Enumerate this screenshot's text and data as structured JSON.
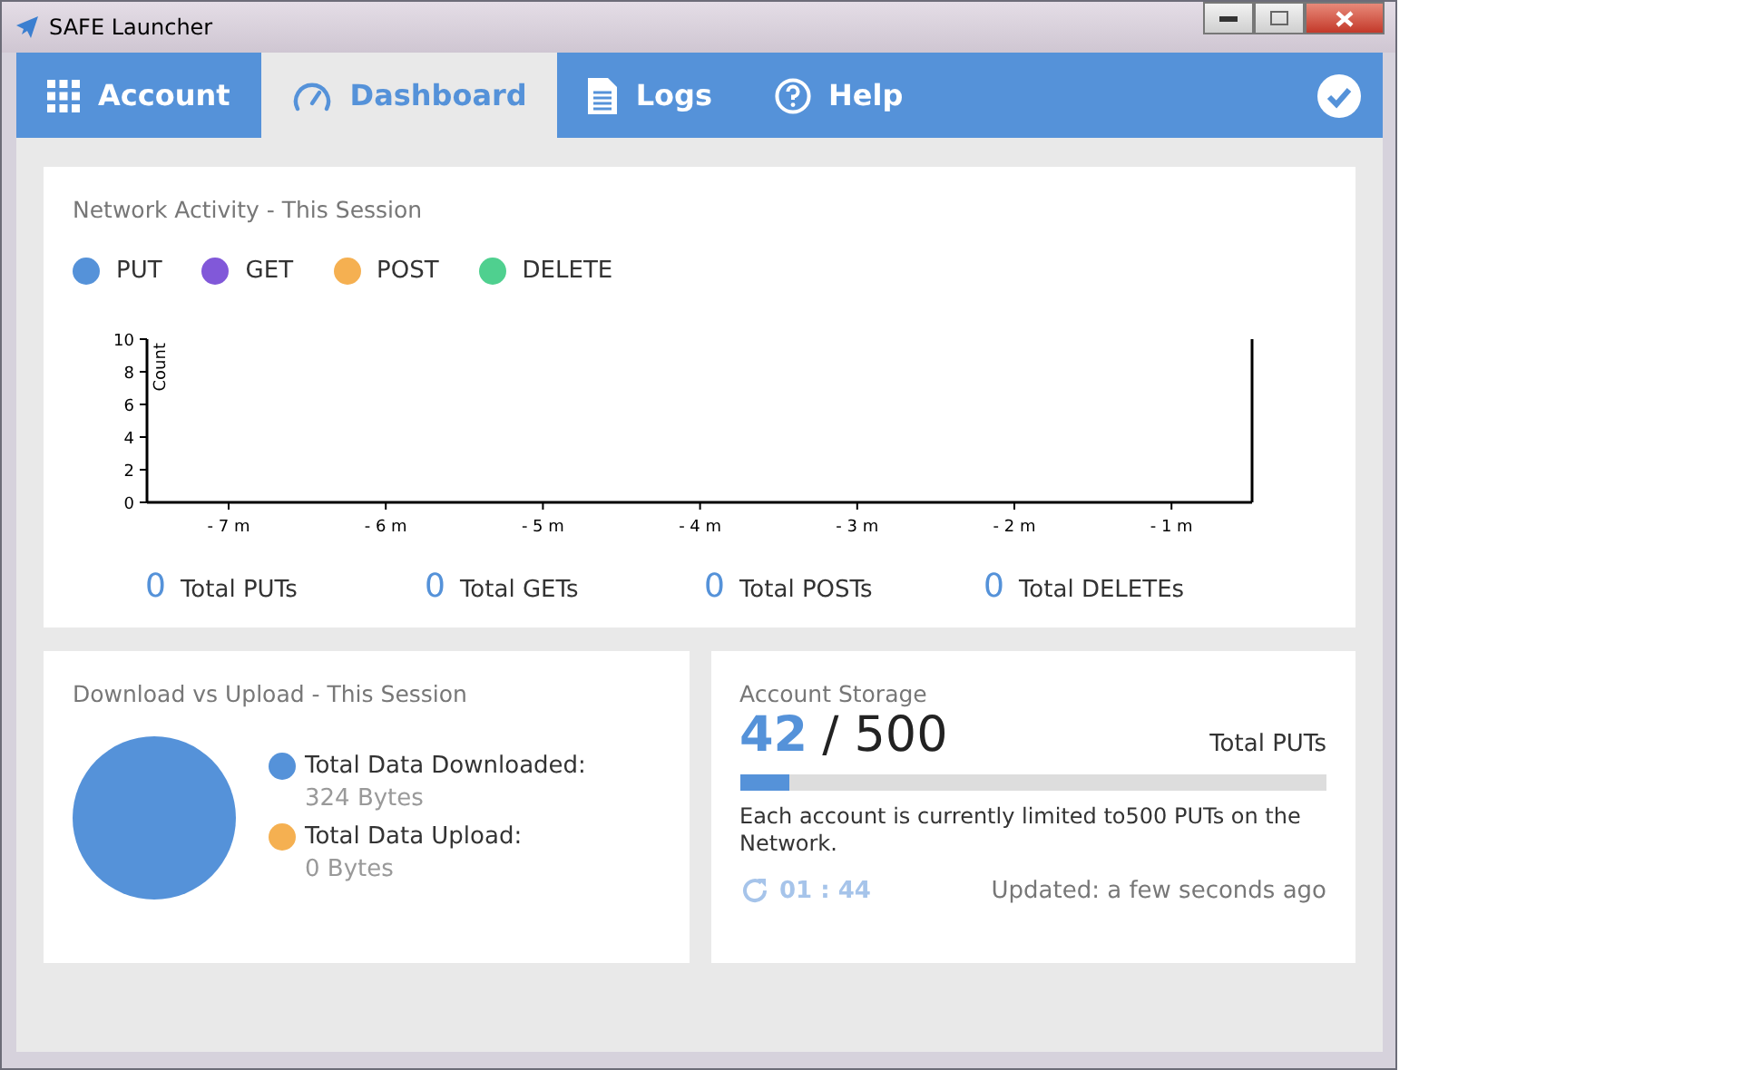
{
  "window": {
    "title": "SAFE Launcher"
  },
  "tabs": [
    {
      "label": "Account",
      "selected": false
    },
    {
      "label": "Dashboard",
      "selected": true
    },
    {
      "label": "Logs",
      "selected": false
    },
    {
      "label": "Help",
      "selected": false
    }
  ],
  "network_activity": {
    "title": "Network Activity - This Session",
    "legend": [
      {
        "label": "PUT",
        "color": "#5592d9"
      },
      {
        "label": "GET",
        "color": "#8158d9"
      },
      {
        "label": "POST",
        "color": "#f5b051"
      },
      {
        "label": "DELETE",
        "color": "#4fd08f"
      }
    ],
    "chart_data": {
      "type": "line",
      "ylabel": "Count",
      "ylim": [
        0,
        10
      ],
      "yticks": [
        0,
        2,
        4,
        6,
        8,
        10
      ],
      "categories": [
        "- 7 m",
        "- 6 m",
        "- 5 m",
        "- 4 m",
        "- 3 m",
        "- 2 m",
        "- 1 m"
      ]
    },
    "totals": [
      {
        "value": "0",
        "label": "Total PUTs"
      },
      {
        "value": "0",
        "label": "Total GETs"
      },
      {
        "value": "0",
        "label": "Total POSTs"
      },
      {
        "value": "0",
        "label": "Total DELETEs"
      }
    ]
  },
  "download_upload": {
    "title": "Download vs Upload - This Session",
    "items": [
      {
        "label": "Total Data Downloaded:",
        "value": "324 Bytes",
        "color": "#5592d9"
      },
      {
        "label": "Total Data Upload:",
        "value": "0 Bytes",
        "color": "#f5b051"
      }
    ]
  },
  "account_storage": {
    "title": "Account Storage",
    "used": "42",
    "limit": "/ 500",
    "unit": "Total PUTs",
    "level": 0.084,
    "note": "Each account is currently limited to500 PUTs on the Network.",
    "timer": "01 : 44",
    "updated": "Updated: a few seconds ago"
  }
}
